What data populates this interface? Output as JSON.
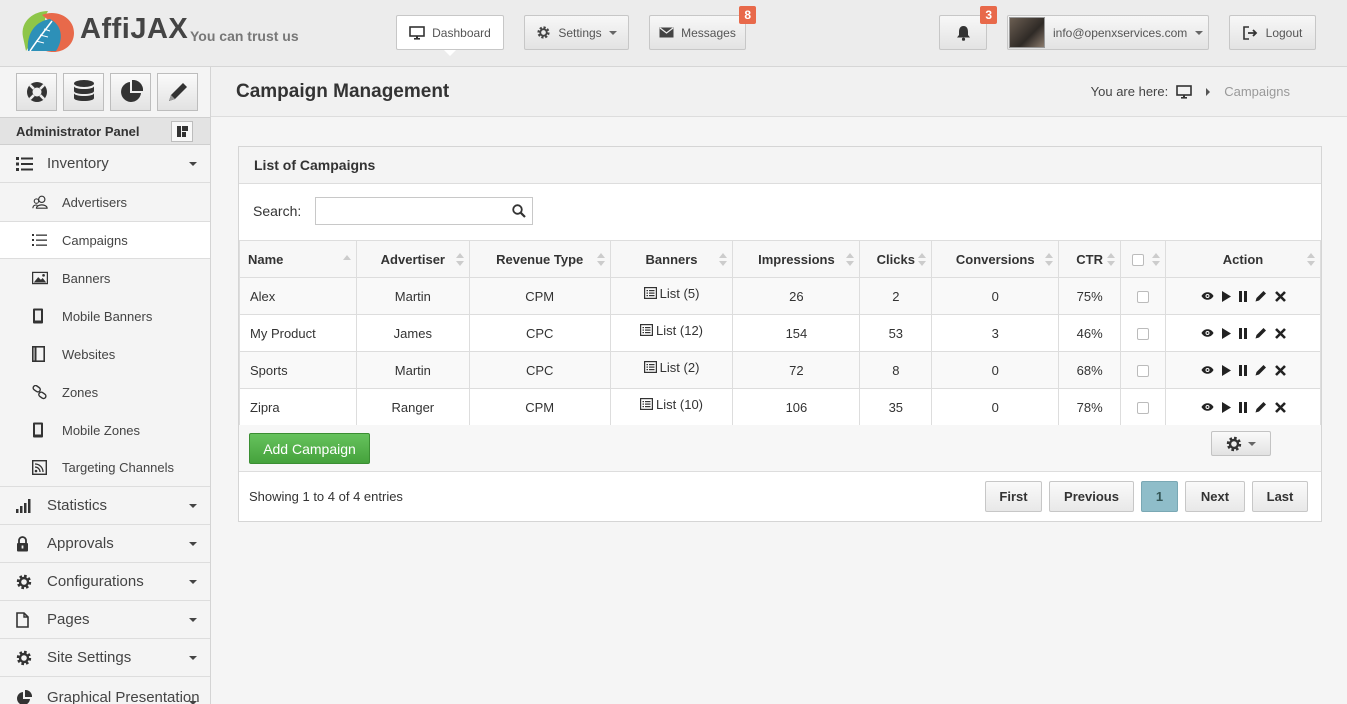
{
  "brand": {
    "name": "AffiJAX",
    "tagline": "You can trust us"
  },
  "topnav": {
    "dashboard": "Dashboard",
    "settings": "Settings",
    "messages": "Messages",
    "messages_badge": "8",
    "notifications_badge": "3",
    "user_email": "info@openxservices.com",
    "logout": "Logout"
  },
  "sidebar": {
    "panel_title": "Administrator Panel",
    "inventory": "Inventory",
    "inventory_items": [
      "Advertisers",
      "Campaigns",
      "Banners",
      "Mobile Banners",
      "Websites",
      "Zones",
      "Mobile Zones",
      "Targeting Channels"
    ],
    "sections": [
      "Statistics",
      "Approvals",
      "Configurations",
      "Pages",
      "Site Settings",
      "Graphical Presentation"
    ]
  },
  "page": {
    "title": "Campaign Management",
    "breadcrumb_prefix": "You are here:",
    "breadcrumb_current": "Campaigns"
  },
  "campaigns": {
    "box_title": "List of Campaigns",
    "search_label": "Search:",
    "search_value": "",
    "columns": [
      "Name",
      "Advertiser",
      "Revenue Type",
      "Banners",
      "Impressions",
      "Clicks",
      "Conversions",
      "CTR",
      "Action"
    ],
    "rows": [
      {
        "name": "Alex",
        "advertiser": "Martin",
        "revenue_type": "CPM",
        "banners": "List (5)",
        "impressions": "26",
        "clicks": "2",
        "conversions": "0",
        "ctr": "75%"
      },
      {
        "name": "My Product",
        "advertiser": "James",
        "revenue_type": "CPC",
        "banners": "List (12)",
        "impressions": "154",
        "clicks": "53",
        "conversions": "3",
        "ctr": "46%"
      },
      {
        "name": "Sports",
        "advertiser": "Martin",
        "revenue_type": "CPC",
        "banners": "List (2)",
        "impressions": "72",
        "clicks": "8",
        "conversions": "0",
        "ctr": "68%"
      },
      {
        "name": "Zipra",
        "advertiser": "Ranger",
        "revenue_type": "CPM",
        "banners": "List (10)",
        "impressions": "106",
        "clicks": "35",
        "conversions": "0",
        "ctr": "78%"
      }
    ],
    "add_button": "Add Campaign",
    "showing": "Showing 1 to 4 of 4 entries",
    "pager": {
      "first": "First",
      "previous": "Previous",
      "current": "1",
      "next": "Next",
      "last": "Last"
    }
  },
  "colors": {
    "accent_green": "#4caf45",
    "badge_orange": "#e8694a",
    "active_page": "#8fbdc9"
  }
}
